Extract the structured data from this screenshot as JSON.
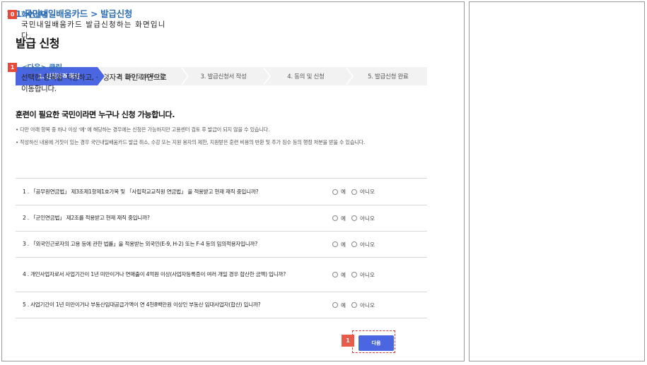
{
  "breadcrumb": "1.1 국민내일배움카드 > 발급신청",
  "page_title": "발급 신청",
  "steps": [
    {
      "label": "1. 신청자격 확인",
      "active": true
    },
    {
      "label": "2. 권리 및 의무사항",
      "active": false
    },
    {
      "label": "3. 발급신청서 작성",
      "active": false
    },
    {
      "label": "4. 동의 및 신청",
      "active": false
    },
    {
      "label": "5. 발급신청 완료",
      "active": false
    }
  ],
  "intro_heading": "훈련이 필요한 국민이라면 누구나 신청 가능합니다.",
  "notices": [
    "• 다만 아래 항목 중 하나 이상 '예' 에 해당하는 경우에는 신청은 가능하지만 고용센터 검토 후 발급이 되지 않을 수 있습니다.",
    "• 작성하신 내용에 거짓이 있는 경우 국민내일배움카드 발급 취소, 수강 또는 지원 용자의 제한, 지원받은 훈련 비용의 반환 및 추가 징수 등의 행정 처분을 받을 수 있습니다."
  ],
  "options": {
    "yes": "예",
    "no": "아니오"
  },
  "questions": [
    "1 . 「공무원연금법」 제3조제1항제1호가목 및 「사립학교교직원 연금법」 을 적용받고 현재 재직 중입니까?",
    "2 . 「군인연금법」 제2조를 적용받고 현재 재직 중입니까?",
    "3 . 「외국인근로자의 고용 등에 관한 법률」을 적용받는 외국인(E-9, H-2) 또는 F-4 등의 임의적용자입니까?",
    "4 . 개인사업자로서 사업기간이 1년 미만이거나 연매출이 4억원 이상(사업자등록증이 여러 개일 경우 합산한 금액) 입니까?",
    "5 . 사업기간이 1년 미만이거나 부동산임대공급가액이 연 4천8백만원 이상인 부동산 임대사업자(합산) 입니까?"
  ],
  "next_button": "다음",
  "next_marker": "1",
  "side": [
    {
      "num": "0",
      "title": "화면설명",
      "desc": "국민내일배움카드 발급신청하는 화면입니다."
    },
    {
      "num": "1",
      "title": "<다음> 클릭",
      "desc": "선택한 항목을 저장하고, 신청자격 확인 화면으로 이동합니다."
    }
  ],
  "colors": {
    "accent": "#4a66e0",
    "link": "#2e6fb5",
    "marker": "#e84a3a"
  }
}
